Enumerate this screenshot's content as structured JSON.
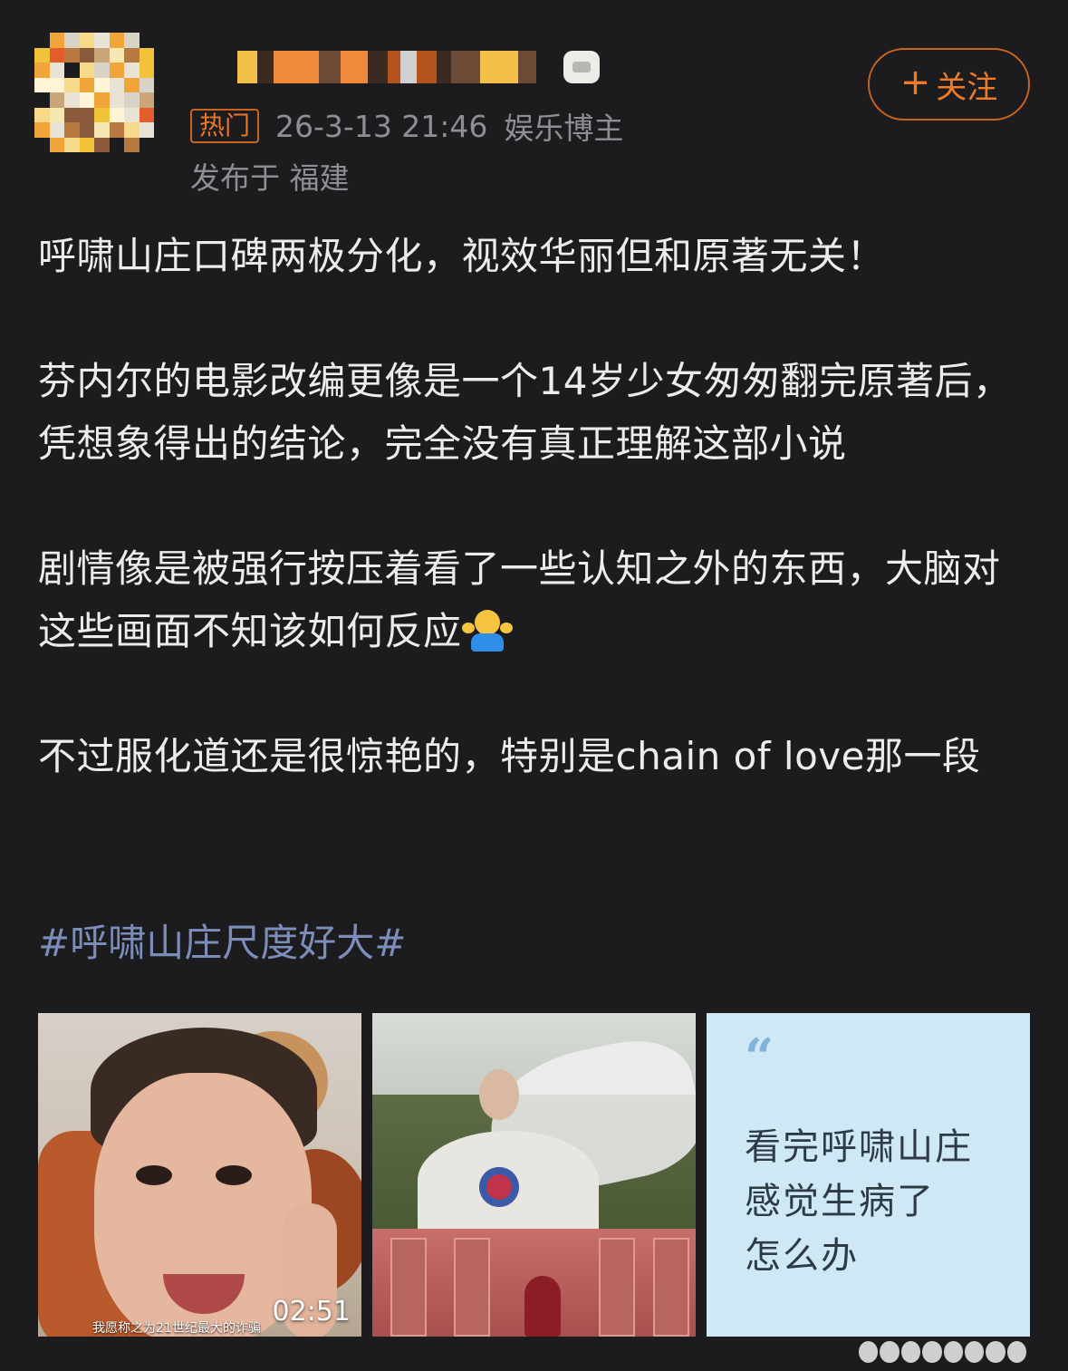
{
  "header": {
    "follow_label": "关注",
    "follow_plus": "+",
    "hot_badge": "热门",
    "timestamp": "26-3-13 21:46",
    "author_tag": "娱乐博主",
    "location": "发布于 福建"
  },
  "post": {
    "paragraphs": [
      "呼啸山庄口碑两极分化，视效华丽但和原著无关！",
      "芬内尔的电影改编更像是一个14岁少女匆匆翻完原著后，凭想象得出的结论，完全没有真正理解这部小说",
      "剧情像是被强行按压着看了一些认知之外的东西，大脑对这些画面不知该如何反应",
      "不过服化道还是很惊艳的，特别是chain of love那一段"
    ],
    "emoji": "shrug-emoji",
    "hashtag": "#呼啸山庄尺度好大#"
  },
  "media": {
    "video_duration": "02:51",
    "video_subtitle": "我愿称之为21世纪最大的诈骗",
    "quote_mark": "“",
    "quote_lines": [
      "看完呼啸山庄",
      "感觉生病了",
      "怎么办"
    ]
  },
  "colors": {
    "background": "#1c1c1e",
    "accent_orange": "#ef7a27",
    "hashtag_blue": "#7b8db8",
    "quote_card_bg": "#cfe8f6"
  }
}
